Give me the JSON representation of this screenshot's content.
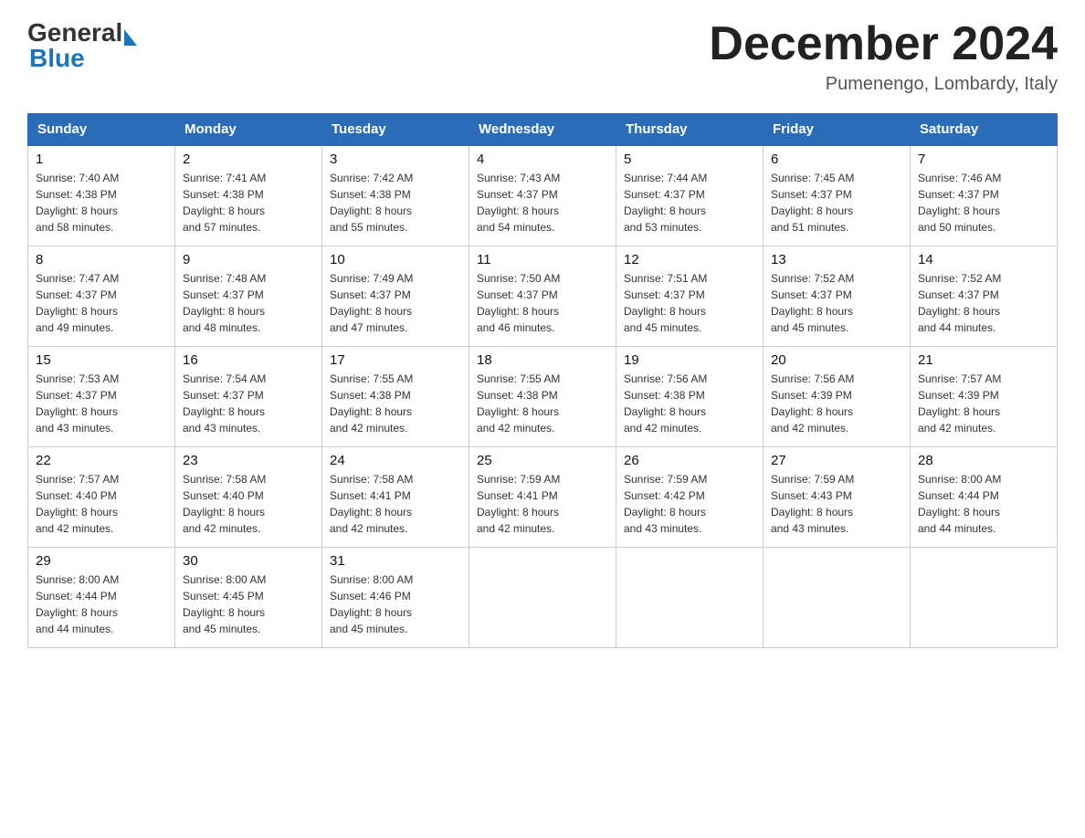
{
  "header": {
    "title": "December 2024",
    "location": "Pumenengo, Lombardy, Italy",
    "logo_general": "General",
    "logo_blue": "Blue"
  },
  "days_of_week": [
    "Sunday",
    "Monday",
    "Tuesday",
    "Wednesday",
    "Thursday",
    "Friday",
    "Saturday"
  ],
  "weeks": [
    [
      {
        "day": "1",
        "sunrise": "7:40 AM",
        "sunset": "4:38 PM",
        "daylight": "8 hours and 58 minutes."
      },
      {
        "day": "2",
        "sunrise": "7:41 AM",
        "sunset": "4:38 PM",
        "daylight": "8 hours and 57 minutes."
      },
      {
        "day": "3",
        "sunrise": "7:42 AM",
        "sunset": "4:38 PM",
        "daylight": "8 hours and 55 minutes."
      },
      {
        "day": "4",
        "sunrise": "7:43 AM",
        "sunset": "4:37 PM",
        "daylight": "8 hours and 54 minutes."
      },
      {
        "day": "5",
        "sunrise": "7:44 AM",
        "sunset": "4:37 PM",
        "daylight": "8 hours and 53 minutes."
      },
      {
        "day": "6",
        "sunrise": "7:45 AM",
        "sunset": "4:37 PM",
        "daylight": "8 hours and 51 minutes."
      },
      {
        "day": "7",
        "sunrise": "7:46 AM",
        "sunset": "4:37 PM",
        "daylight": "8 hours and 50 minutes."
      }
    ],
    [
      {
        "day": "8",
        "sunrise": "7:47 AM",
        "sunset": "4:37 PM",
        "daylight": "8 hours and 49 minutes."
      },
      {
        "day": "9",
        "sunrise": "7:48 AM",
        "sunset": "4:37 PM",
        "daylight": "8 hours and 48 minutes."
      },
      {
        "day": "10",
        "sunrise": "7:49 AM",
        "sunset": "4:37 PM",
        "daylight": "8 hours and 47 minutes."
      },
      {
        "day": "11",
        "sunrise": "7:50 AM",
        "sunset": "4:37 PM",
        "daylight": "8 hours and 46 minutes."
      },
      {
        "day": "12",
        "sunrise": "7:51 AM",
        "sunset": "4:37 PM",
        "daylight": "8 hours and 45 minutes."
      },
      {
        "day": "13",
        "sunrise": "7:52 AM",
        "sunset": "4:37 PM",
        "daylight": "8 hours and 45 minutes."
      },
      {
        "day": "14",
        "sunrise": "7:52 AM",
        "sunset": "4:37 PM",
        "daylight": "8 hours and 44 minutes."
      }
    ],
    [
      {
        "day": "15",
        "sunrise": "7:53 AM",
        "sunset": "4:37 PM",
        "daylight": "8 hours and 43 minutes."
      },
      {
        "day": "16",
        "sunrise": "7:54 AM",
        "sunset": "4:37 PM",
        "daylight": "8 hours and 43 minutes."
      },
      {
        "day": "17",
        "sunrise": "7:55 AM",
        "sunset": "4:38 PM",
        "daylight": "8 hours and 42 minutes."
      },
      {
        "day": "18",
        "sunrise": "7:55 AM",
        "sunset": "4:38 PM",
        "daylight": "8 hours and 42 minutes."
      },
      {
        "day": "19",
        "sunrise": "7:56 AM",
        "sunset": "4:38 PM",
        "daylight": "8 hours and 42 minutes."
      },
      {
        "day": "20",
        "sunrise": "7:56 AM",
        "sunset": "4:39 PM",
        "daylight": "8 hours and 42 minutes."
      },
      {
        "day": "21",
        "sunrise": "7:57 AM",
        "sunset": "4:39 PM",
        "daylight": "8 hours and 42 minutes."
      }
    ],
    [
      {
        "day": "22",
        "sunrise": "7:57 AM",
        "sunset": "4:40 PM",
        "daylight": "8 hours and 42 minutes."
      },
      {
        "day": "23",
        "sunrise": "7:58 AM",
        "sunset": "4:40 PM",
        "daylight": "8 hours and 42 minutes."
      },
      {
        "day": "24",
        "sunrise": "7:58 AM",
        "sunset": "4:41 PM",
        "daylight": "8 hours and 42 minutes."
      },
      {
        "day": "25",
        "sunrise": "7:59 AM",
        "sunset": "4:41 PM",
        "daylight": "8 hours and 42 minutes."
      },
      {
        "day": "26",
        "sunrise": "7:59 AM",
        "sunset": "4:42 PM",
        "daylight": "8 hours and 43 minutes."
      },
      {
        "day": "27",
        "sunrise": "7:59 AM",
        "sunset": "4:43 PM",
        "daylight": "8 hours and 43 minutes."
      },
      {
        "day": "28",
        "sunrise": "8:00 AM",
        "sunset": "4:44 PM",
        "daylight": "8 hours and 44 minutes."
      }
    ],
    [
      {
        "day": "29",
        "sunrise": "8:00 AM",
        "sunset": "4:44 PM",
        "daylight": "8 hours and 44 minutes."
      },
      {
        "day": "30",
        "sunrise": "8:00 AM",
        "sunset": "4:45 PM",
        "daylight": "8 hours and 45 minutes."
      },
      {
        "day": "31",
        "sunrise": "8:00 AM",
        "sunset": "4:46 PM",
        "daylight": "8 hours and 45 minutes."
      },
      null,
      null,
      null,
      null
    ]
  ],
  "labels": {
    "sunrise": "Sunrise:",
    "sunset": "Sunset:",
    "daylight": "Daylight:"
  }
}
